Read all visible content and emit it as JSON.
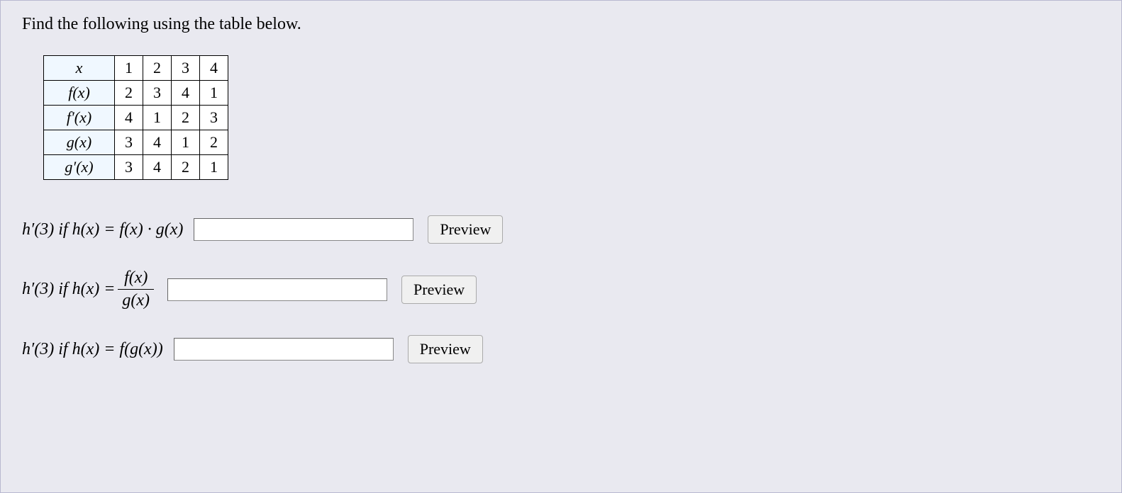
{
  "intro": "Find the following using the table below.",
  "table": {
    "header": {
      "label": "x",
      "values": [
        "1",
        "2",
        "3",
        "4"
      ]
    },
    "rows": [
      {
        "label": "f(x)",
        "values": [
          "2",
          "3",
          "4",
          "1"
        ]
      },
      {
        "label": "f′(x)",
        "values": [
          "4",
          "1",
          "2",
          "3"
        ]
      },
      {
        "label": "g(x)",
        "values": [
          "3",
          "4",
          "1",
          "2"
        ]
      },
      {
        "label": "g′(x)",
        "values": [
          "3",
          "4",
          "2",
          "1"
        ]
      }
    ]
  },
  "questions": {
    "q1": {
      "prefix": "h′(3) if h(x) = f(x) · g(x)",
      "preview": "Preview"
    },
    "q2": {
      "prefix_left": "h′(3) if h(x) = ",
      "frac_num": "f(x)",
      "frac_den": "g(x)",
      "preview": "Preview"
    },
    "q3": {
      "prefix": "h′(3) if h(x) = f(g(x))",
      "preview": "Preview"
    }
  }
}
